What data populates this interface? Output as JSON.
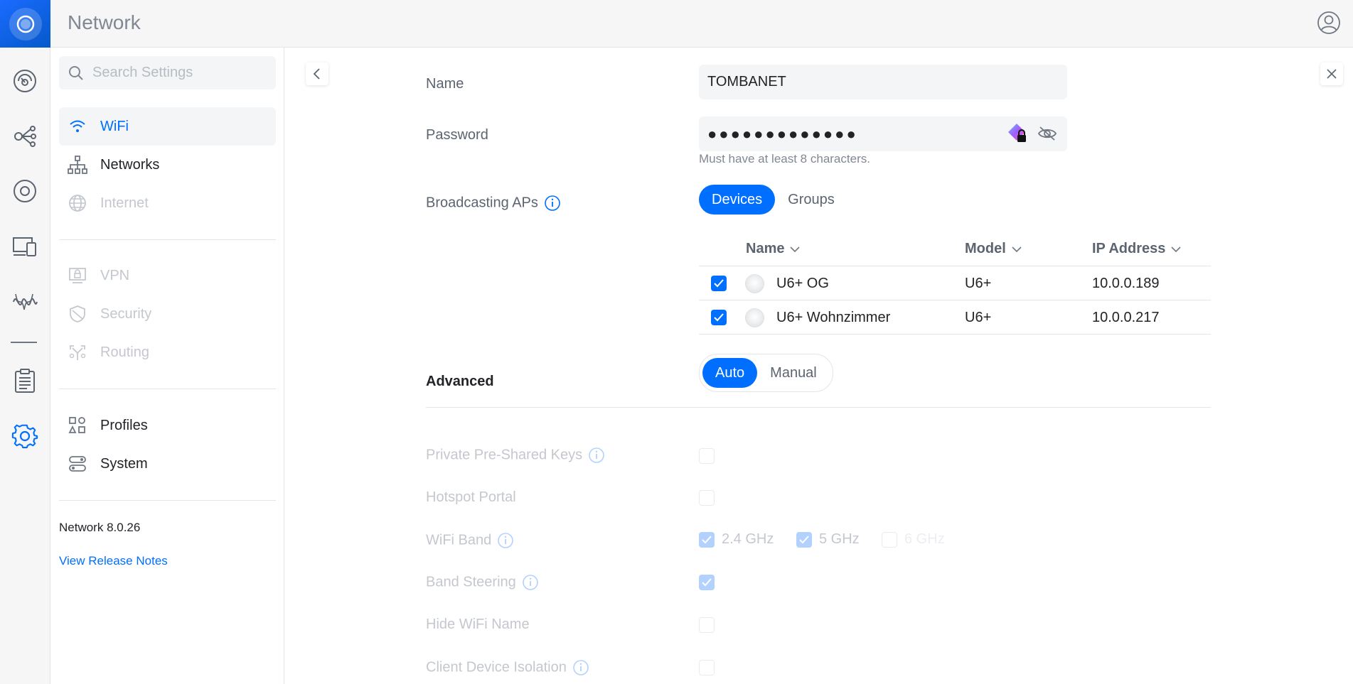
{
  "app": {
    "title": "Network"
  },
  "rail": {
    "items": [
      {
        "name": "dashboard"
      },
      {
        "name": "topology"
      },
      {
        "name": "unifi-devices"
      },
      {
        "name": "client-devices"
      },
      {
        "name": "insights"
      },
      {
        "name": "system-log"
      },
      {
        "name": "settings",
        "active": true
      }
    ]
  },
  "sidebar": {
    "search_placeholder": "Search Settings",
    "items": [
      {
        "label": "WiFi",
        "icon": "wifi-icon",
        "active": true
      },
      {
        "label": "Networks",
        "icon": "networks-icon"
      },
      {
        "label": "Internet",
        "icon": "globe-icon",
        "disabled": true
      },
      {
        "label": "VPN",
        "icon": "vpn-icon",
        "disabled": true
      },
      {
        "label": "Security",
        "icon": "shield-icon",
        "disabled": true
      },
      {
        "label": "Routing",
        "icon": "routing-icon",
        "disabled": true
      },
      {
        "label": "Profiles",
        "icon": "profiles-icon"
      },
      {
        "label": "System",
        "icon": "system-icon"
      }
    ],
    "version": "Network 8.0.26",
    "release_notes": "View Release Notes"
  },
  "form": {
    "name_label": "Name",
    "name_value": "TOMBANET",
    "password_label": "Password",
    "password_value": "●●●●●●●●●●●●●",
    "password_hint": "Must have at least 8 characters.",
    "broadcasting_label": "Broadcasting APs",
    "broadcast_tabs": {
      "devices": "Devices",
      "groups": "Groups",
      "selected": "Devices"
    },
    "table": {
      "headers": {
        "name": "Name",
        "model": "Model",
        "ip": "IP Address"
      },
      "rows": [
        {
          "checked": true,
          "name": "U6+ OG",
          "model": "U6+",
          "ip": "10.0.0.189"
        },
        {
          "checked": true,
          "name": "U6+ Wohnzimmer",
          "model": "U6+",
          "ip": "10.0.0.217"
        }
      ]
    },
    "advanced_label": "Advanced",
    "advanced_modes": {
      "auto": "Auto",
      "manual": "Manual",
      "selected": "Auto"
    },
    "advanced": {
      "ppsk_label": "Private Pre-Shared Keys",
      "ppsk_checked": false,
      "hotspot_label": "Hotspot Portal",
      "hotspot_checked": false,
      "wifi_band_label": "WiFi Band",
      "bands": [
        {
          "label": "2.4 GHz",
          "checked": true
        },
        {
          "label": "5 GHz",
          "checked": true
        },
        {
          "label": "6 GHz",
          "checked": false
        }
      ],
      "band_steering_label": "Band Steering",
      "band_steering_checked": true,
      "hide_name_label": "Hide WiFi Name",
      "hide_name_checked": false,
      "isolation_label": "Client Device Isolation",
      "isolation_checked": false
    }
  },
  "colors": {
    "accent": "#006fff",
    "muted": "#c4c8ce",
    "rail_bg": "#f6f6f7"
  }
}
